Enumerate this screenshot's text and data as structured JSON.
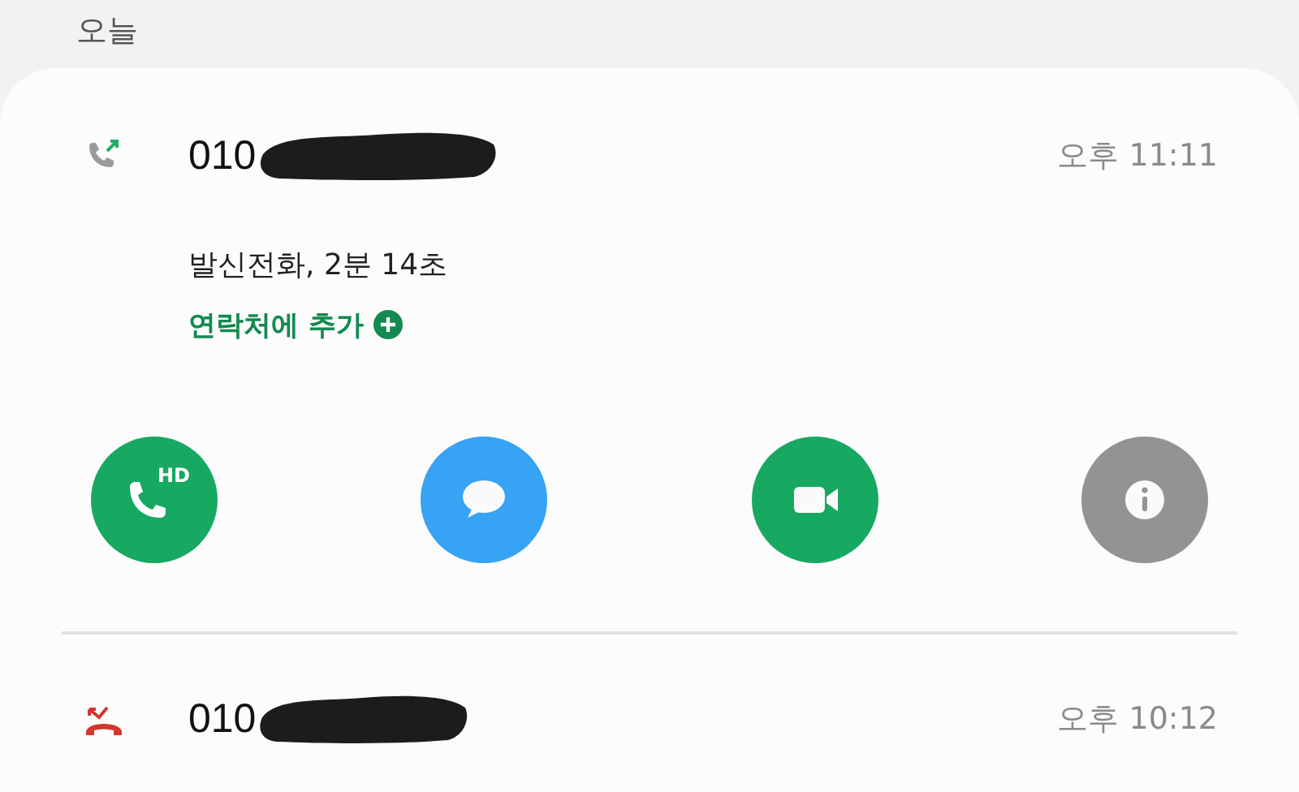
{
  "section_header": "오늘",
  "calls": [
    {
      "kind": "outgoing",
      "number": "010",
      "time": "오후 11:11",
      "expanded": true,
      "detail": "발신전화, 2분 14초",
      "add_contact": "연락처에 추가",
      "actions": [
        {
          "kind": "call",
          "label": "HD"
        },
        {
          "kind": "message"
        },
        {
          "kind": "video"
        },
        {
          "kind": "info"
        }
      ]
    },
    {
      "kind": "missed",
      "number": "010",
      "time": "오후 10:12",
      "expanded": false
    }
  ]
}
